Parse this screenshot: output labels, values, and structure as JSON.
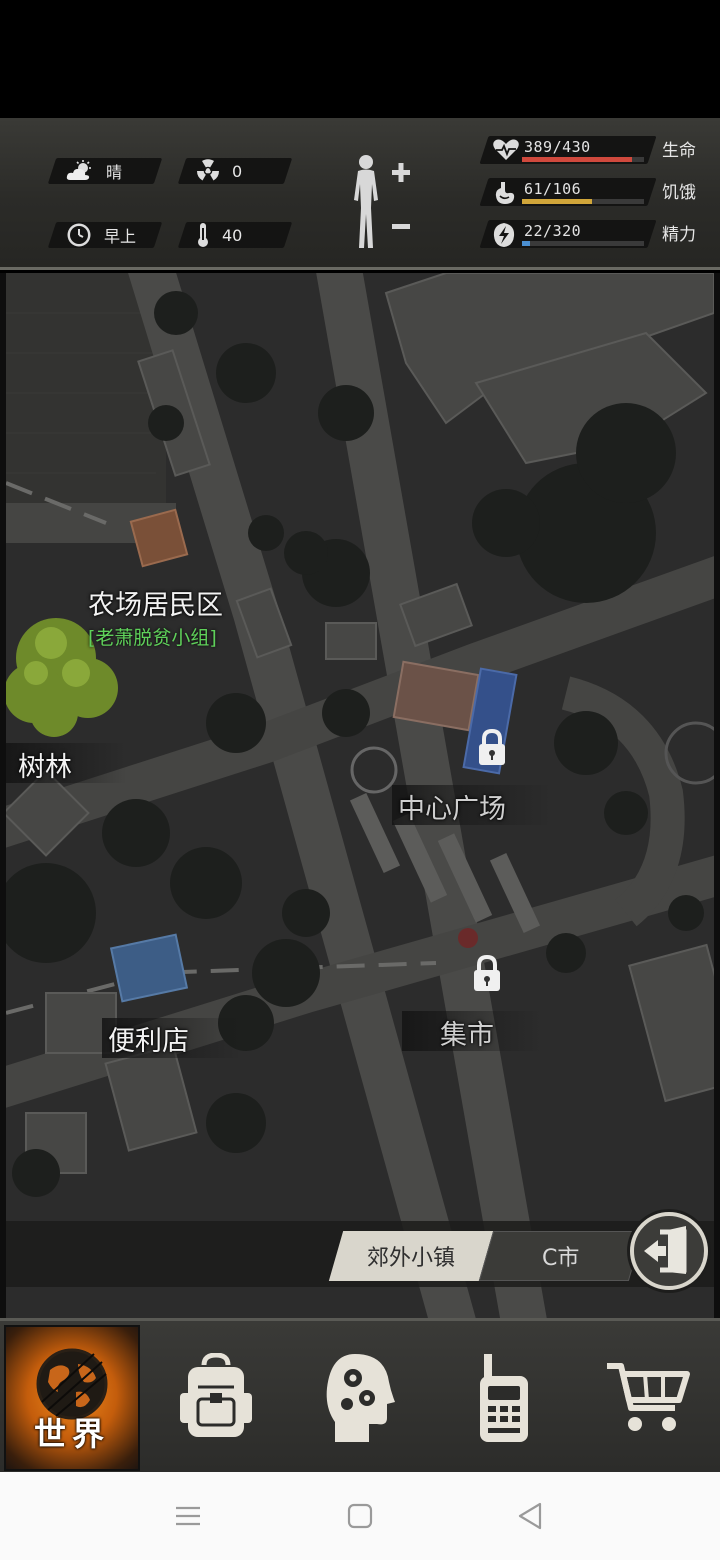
{
  "hud": {
    "weather": {
      "icon": "cloud-sun-icon",
      "label": "晴"
    },
    "radiation": {
      "icon": "radiation-icon",
      "value": "0"
    },
    "time": {
      "icon": "clock-icon",
      "label": "早上"
    },
    "temperature": {
      "icon": "thermometer-icon",
      "value": "40"
    },
    "vitals": [
      {
        "key": "health",
        "icon": "heart-icon",
        "value": "389/430",
        "label": "生命",
        "ratio": 0.905,
        "color": "#d0493d"
      },
      {
        "key": "hunger",
        "icon": "stomach-icon",
        "value": "61/106",
        "label": "饥饿",
        "ratio": 0.575,
        "color": "#d1a63a"
      },
      {
        "key": "energy",
        "icon": "energy-icon",
        "value": "22/320",
        "label": "精力",
        "ratio": 0.069,
        "color": "#4b8fd1"
      }
    ]
  },
  "map": {
    "locations": {
      "farm": {
        "name": "农场居民区",
        "group": "[老萧脱贫小组]"
      },
      "forest": {
        "name": "树林"
      },
      "center_plaza": {
        "name": "中心广场",
        "locked": true
      },
      "market": {
        "name": "集市",
        "locked": true
      },
      "store": {
        "name": "便利店"
      }
    },
    "regions": [
      {
        "label": "郊外小镇",
        "active": true
      },
      {
        "label": "C市",
        "active": false
      }
    ]
  },
  "nav": {
    "items": [
      {
        "key": "world",
        "label": "世界",
        "icon": "globe-icon",
        "active": true
      },
      {
        "key": "backpack",
        "icon": "backpack-icon"
      },
      {
        "key": "skills",
        "icon": "head-gears-icon"
      },
      {
        "key": "radio",
        "icon": "walkie-talkie-icon"
      },
      {
        "key": "shop",
        "icon": "shopping-cart-icon"
      }
    ]
  }
}
